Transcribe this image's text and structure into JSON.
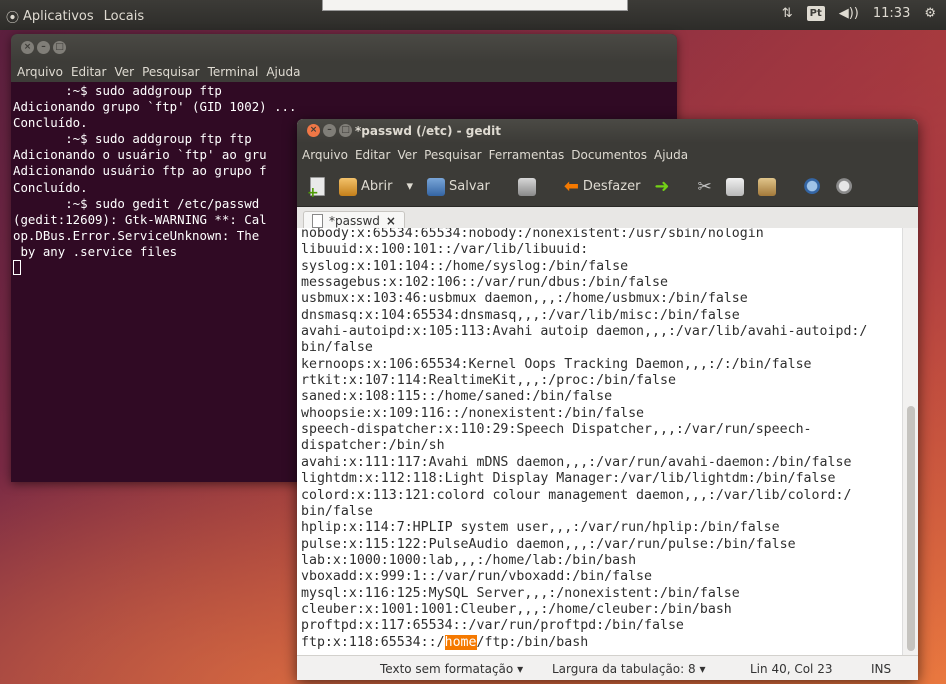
{
  "top_panel": {
    "apps_label": "Aplicativos",
    "places_label": "Locais",
    "keyboard_layout": "Pt",
    "volume_icon": "speaker-icon",
    "clock": "11:33"
  },
  "terminal": {
    "menu": [
      "Arquivo",
      "Editar",
      "Ver",
      "Pesquisar",
      "Terminal",
      "Ajuda"
    ],
    "lines": [
      "       :~$ sudo addgroup ftp",
      "Adicionando grupo `ftp' (GID 1002) ...",
      "Concluído.",
      "       :~$ sudo addgroup ftp ftp",
      "Adicionando o usuário `ftp' ao gru",
      "Adicionando usuário ftp ao grupo f",
      "Concluído.",
      "       :~$ sudo gedit /etc/passwd",
      "",
      "(gedit:12609): Gtk-WARNING **: Cal",
      "op.DBus.Error.ServiceUnknown: The ",
      " by any .service files"
    ]
  },
  "gedit": {
    "title": "*passwd (/etc) - gedit",
    "menu": [
      "Arquivo",
      "Editar",
      "Ver",
      "Pesquisar",
      "Ferramentas",
      "Documentos",
      "Ajuda"
    ],
    "toolbar": {
      "open_label": "Abrir",
      "save_label": "Salvar",
      "undo_label": "Desfazer"
    },
    "tab_label": "*passwd",
    "lines": [
      "nobody:x:65534:65534:nobody:/nonexistent:/usr/sbin/nologin",
      "libuuid:x:100:101::/var/lib/libuuid:",
      "syslog:x:101:104::/home/syslog:/bin/false",
      "messagebus:x:102:106::/var/run/dbus:/bin/false",
      "usbmux:x:103:46:usbmux daemon,,,:/home/usbmux:/bin/false",
      "dnsmasq:x:104:65534:dnsmasq,,,:/var/lib/misc:/bin/false",
      "avahi-autoipd:x:105:113:Avahi autoip daemon,,,:/var/lib/avahi-autoipd:/",
      "bin/false",
      "kernoops:x:106:65534:Kernel Oops Tracking Daemon,,,:/:/bin/false",
      "rtkit:x:107:114:RealtimeKit,,,:/proc:/bin/false",
      "saned:x:108:115::/home/saned:/bin/false",
      "whoopsie:x:109:116::/nonexistent:/bin/false",
      "speech-dispatcher:x:110:29:Speech Dispatcher,,,:/var/run/speech-",
      "dispatcher:/bin/sh",
      "avahi:x:111:117:Avahi mDNS daemon,,,:/var/run/avahi-daemon:/bin/false",
      "lightdm:x:112:118:Light Display Manager:/var/lib/lightdm:/bin/false",
      "colord:x:113:121:colord colour management daemon,,,:/var/lib/colord:/",
      "bin/false",
      "hplip:x:114:7:HPLIP system user,,,:/var/run/hplip:/bin/false",
      "pulse:x:115:122:PulseAudio daemon,,,:/var/run/pulse:/bin/false",
      "lab:x:1000:1000:lab,,,:/home/lab:/bin/bash",
      "vboxadd:x:999:1::/var/run/vboxadd:/bin/false",
      "mysql:x:116:125:MySQL Server,,,:/nonexistent:/bin/false",
      "cleuber:x:1001:1001:Cleuber,,,:/home/cleuber:/bin/bash",
      "proftpd:x:117:65534::/var/run/proftpd:/bin/false"
    ],
    "last_line": {
      "prefix": "ftp:x:118:65534::/",
      "selected": "home",
      "suffix": "/ftp:/bin/bash"
    },
    "status": {
      "syntax": "Texto sem formatação",
      "tab_width": "Largura da tabulação: 8",
      "position": "Lin 40, Col 23",
      "mode": "INS"
    }
  }
}
